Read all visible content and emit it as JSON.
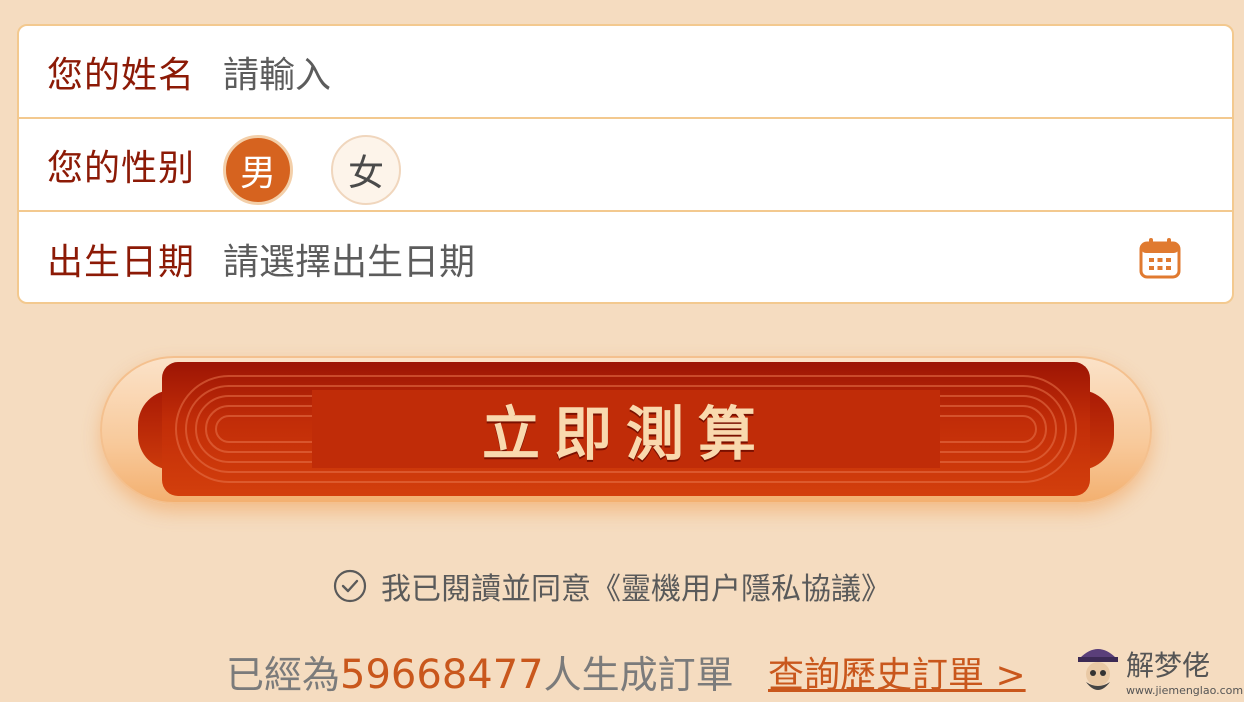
{
  "form": {
    "name": {
      "label": "您的姓名",
      "placeholder": "請輸入"
    },
    "gender": {
      "label": "您的性别",
      "male": "男",
      "female": "女",
      "selected": "男"
    },
    "birth": {
      "label": "出生日期",
      "placeholder": "請選擇出生日期",
      "icon": "calendar-icon"
    }
  },
  "submit": {
    "label": "立即測算"
  },
  "agreement": {
    "text": "我已閱讀並同意《靈機用户隱私協議》",
    "icon": "check-circle-icon",
    "checked": true
  },
  "footer": {
    "prefix": "已經為",
    "count": "59668477",
    "suffix": "人生成訂單",
    "history_link": "查詢歷史訂單 >"
  },
  "watermark": {
    "title": "解梦佬",
    "url": "www.jiemenglao.com"
  },
  "colors": {
    "background": "#f5dcc0",
    "label": "#8c1a06",
    "accent": "#d6631f",
    "button": "#c22d08",
    "button_text": "#f9d9ae",
    "border": "#f3c98f"
  }
}
